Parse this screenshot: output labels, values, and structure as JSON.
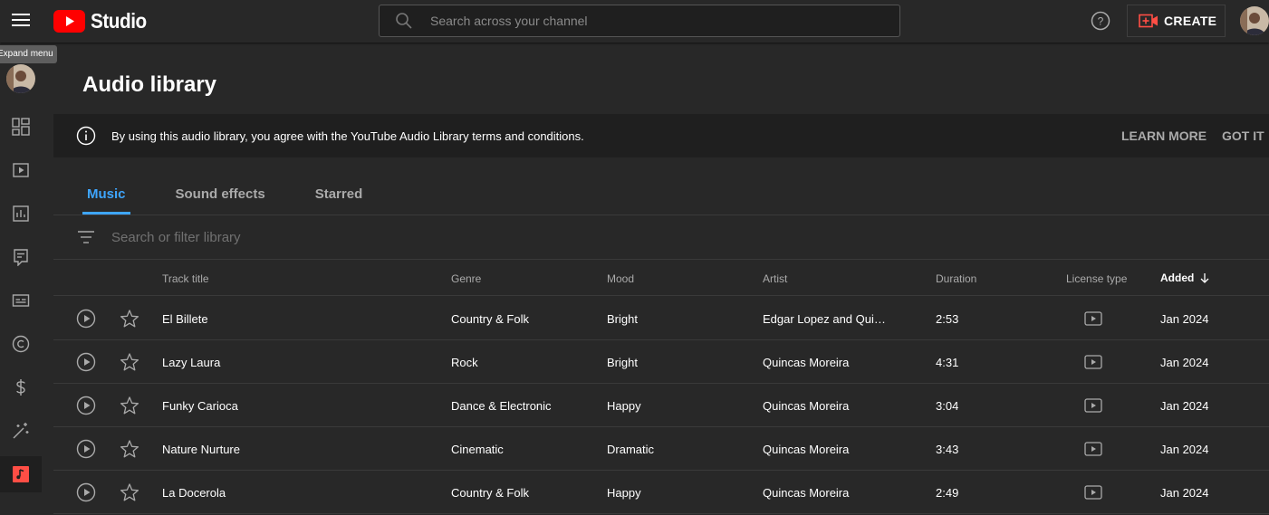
{
  "app": {
    "name": "Studio",
    "brand_color": "#ff0000"
  },
  "header": {
    "search_placeholder": "Search across your channel",
    "create_label": "CREATE"
  },
  "sidebar": {
    "tooltip": "Expand menu",
    "items": [
      {
        "icon": "dashboard-icon"
      },
      {
        "icon": "content-icon"
      },
      {
        "icon": "analytics-icon"
      },
      {
        "icon": "comments-icon"
      },
      {
        "icon": "subtitles-icon"
      },
      {
        "icon": "copyright-icon"
      },
      {
        "icon": "earn-icon"
      },
      {
        "icon": "customization-icon"
      },
      {
        "icon": "audio-library-icon",
        "active": true
      }
    ]
  },
  "page": {
    "title": "Audio library",
    "banner": {
      "text": "By using this audio library, you agree with the YouTube Audio Library terms and conditions.",
      "learn_more": "LEARN MORE",
      "got_it": "GOT IT"
    },
    "tabs": [
      {
        "label": "Music",
        "active": true
      },
      {
        "label": "Sound effects",
        "active": false
      },
      {
        "label": "Starred",
        "active": false
      }
    ],
    "filter_placeholder": "Search or filter library",
    "accent_color": "#3ea6ff"
  },
  "table": {
    "columns": {
      "title": "Track title",
      "genre": "Genre",
      "mood": "Mood",
      "artist": "Artist",
      "duration": "Duration",
      "license": "License type",
      "added": "Added"
    },
    "rows": [
      {
        "title": "El Billete",
        "genre": "Country & Folk",
        "mood": "Bright",
        "artist": "Edgar Lopez and Quincas Moreira",
        "duration": "2:53",
        "added": "Jan 2024"
      },
      {
        "title": "Lazy Laura",
        "genre": "Rock",
        "mood": "Bright",
        "artist": "Quincas Moreira",
        "duration": "4:31",
        "added": "Jan 2024"
      },
      {
        "title": "Funky Carioca",
        "genre": "Dance & Electronic",
        "mood": "Happy",
        "artist": "Quincas Moreira",
        "duration": "3:04",
        "added": "Jan 2024"
      },
      {
        "title": "Nature Nurture",
        "genre": "Cinematic",
        "mood": "Dramatic",
        "artist": "Quincas Moreira",
        "duration": "3:43",
        "added": "Jan 2024"
      },
      {
        "title": "La Docerola",
        "genre": "Country & Folk",
        "mood": "Happy",
        "artist": "Quincas Moreira",
        "duration": "2:49",
        "added": "Jan 2024"
      }
    ]
  }
}
